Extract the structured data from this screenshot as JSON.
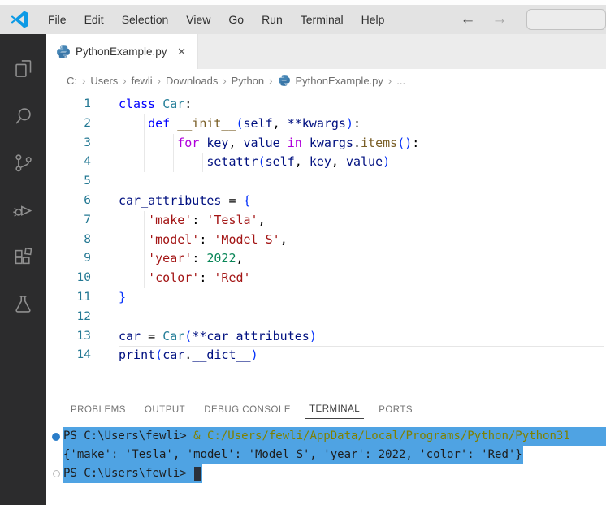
{
  "titlebar": {
    "menus": [
      "File",
      "Edit",
      "Selection",
      "View",
      "Go",
      "Run",
      "Terminal",
      "Help"
    ],
    "back_icon": "←",
    "forward_icon": "→",
    "search_value": ""
  },
  "activity_bar": {
    "items": [
      "explorer-icon",
      "search-icon",
      "source-control-icon",
      "run-debug-icon",
      "extensions-icon",
      "testing-icon"
    ]
  },
  "tab": {
    "label": "PythonExample.py",
    "close_icon": "✕"
  },
  "breadcrumb": {
    "segments": [
      "C:",
      "Users",
      "fewli",
      "Downloads",
      "Python"
    ],
    "file": "PythonExample.py",
    "separator": "›",
    "trailing": "..."
  },
  "editor": {
    "lines": [
      {
        "num": "1",
        "guides": [],
        "tokens": [
          [
            "kw",
            "class "
          ],
          [
            "cls",
            "Car"
          ],
          [
            "pun",
            ":"
          ]
        ]
      },
      {
        "num": "2",
        "guides": [
          4
        ],
        "tokens": [
          [
            "pun",
            "    "
          ],
          [
            "kw",
            "def "
          ],
          [
            "fn",
            "__init__"
          ],
          [
            "brk",
            "("
          ],
          [
            "var",
            "self"
          ],
          [
            "pun",
            ", "
          ],
          [
            "var",
            "**kwargs"
          ],
          [
            "brk",
            ")"
          ],
          [
            "pun",
            ":"
          ]
        ]
      },
      {
        "num": "3",
        "guides": [
          4,
          8
        ],
        "tokens": [
          [
            "pun",
            "        "
          ],
          [
            "ctrl",
            "for "
          ],
          [
            "var",
            "key"
          ],
          [
            "pun",
            ", "
          ],
          [
            "var",
            "value"
          ],
          [
            "ctrl",
            " in "
          ],
          [
            "var",
            "kwargs"
          ],
          [
            "pun",
            "."
          ],
          [
            "fn",
            "items"
          ],
          [
            "brk",
            "()"
          ],
          [
            "pun",
            ":"
          ]
        ]
      },
      {
        "num": "4",
        "guides": [
          4,
          8,
          12
        ],
        "tokens": [
          [
            "pun",
            "            "
          ],
          [
            "var",
            "setattr"
          ],
          [
            "brk",
            "("
          ],
          [
            "var",
            "self"
          ],
          [
            "pun",
            ", "
          ],
          [
            "var",
            "key"
          ],
          [
            "pun",
            ", "
          ],
          [
            "var",
            "value"
          ],
          [
            "brk",
            ")"
          ]
        ]
      },
      {
        "num": "5",
        "guides": [],
        "tokens": []
      },
      {
        "num": "6",
        "guides": [],
        "tokens": [
          [
            "var",
            "car_attributes"
          ],
          [
            "pun",
            " = "
          ],
          [
            "brk",
            "{"
          ]
        ]
      },
      {
        "num": "7",
        "guides": [
          4
        ],
        "tokens": [
          [
            "pun",
            "    "
          ],
          [
            "str",
            "'make'"
          ],
          [
            "pun",
            ": "
          ],
          [
            "str",
            "'Tesla'"
          ],
          [
            "pun",
            ","
          ]
        ]
      },
      {
        "num": "8",
        "guides": [
          4
        ],
        "tokens": [
          [
            "pun",
            "    "
          ],
          [
            "str",
            "'model'"
          ],
          [
            "pun",
            ": "
          ],
          [
            "str",
            "'Model S'"
          ],
          [
            "pun",
            ","
          ]
        ]
      },
      {
        "num": "9",
        "guides": [
          4
        ],
        "tokens": [
          [
            "pun",
            "    "
          ],
          [
            "str",
            "'year'"
          ],
          [
            "pun",
            ": "
          ],
          [
            "num",
            "2022"
          ],
          [
            "pun",
            ","
          ]
        ]
      },
      {
        "num": "10",
        "guides": [
          4
        ],
        "tokens": [
          [
            "pun",
            "    "
          ],
          [
            "str",
            "'color'"
          ],
          [
            "pun",
            ": "
          ],
          [
            "str",
            "'Red'"
          ]
        ]
      },
      {
        "num": "11",
        "guides": [],
        "tokens": [
          [
            "brk",
            "}"
          ]
        ]
      },
      {
        "num": "12",
        "guides": [],
        "tokens": []
      },
      {
        "num": "13",
        "guides": [],
        "tokens": [
          [
            "var",
            "car"
          ],
          [
            "pun",
            " = "
          ],
          [
            "cls",
            "Car"
          ],
          [
            "brk",
            "("
          ],
          [
            "var",
            "**car_attributes"
          ],
          [
            "brk",
            ")"
          ]
        ]
      },
      {
        "num": "14",
        "guides": [],
        "current": true,
        "tokens": [
          [
            "var",
            "print"
          ],
          [
            "brk",
            "("
          ],
          [
            "var",
            "car"
          ],
          [
            "pun",
            "."
          ],
          [
            "var",
            "__dict__"
          ],
          [
            "brk",
            ")"
          ]
        ]
      }
    ]
  },
  "panel": {
    "tabs": [
      "PROBLEMS",
      "OUTPUT",
      "DEBUG CONSOLE",
      "TERMINAL",
      "PORTS"
    ],
    "active_tab": "TERMINAL"
  },
  "terminal": {
    "selection_color": "#4fa3e3",
    "command_color": "#7f8000",
    "lines": [
      {
        "decoration": "run-dot",
        "selected": true,
        "full_width": true,
        "tokens": [
          [
            "t-k",
            "PS C:\\Users\\fewli> "
          ],
          [
            "t-cmd",
            "& C:/Users/fewli/AppData/Local/Programs/Python/Python31"
          ]
        ]
      },
      {
        "decoration": null,
        "selected": true,
        "full_width": false,
        "tokens": [
          [
            "t-k",
            "{'make': 'Tesla', 'model': 'Model S', 'year': 2022, 'color': 'Red'}"
          ]
        ]
      },
      {
        "decoration": "prompt-circle",
        "selected": true,
        "full_width": false,
        "cursor": true,
        "tokens": [
          [
            "t-k",
            "PS C:\\Users\\fewli> "
          ]
        ]
      }
    ]
  }
}
